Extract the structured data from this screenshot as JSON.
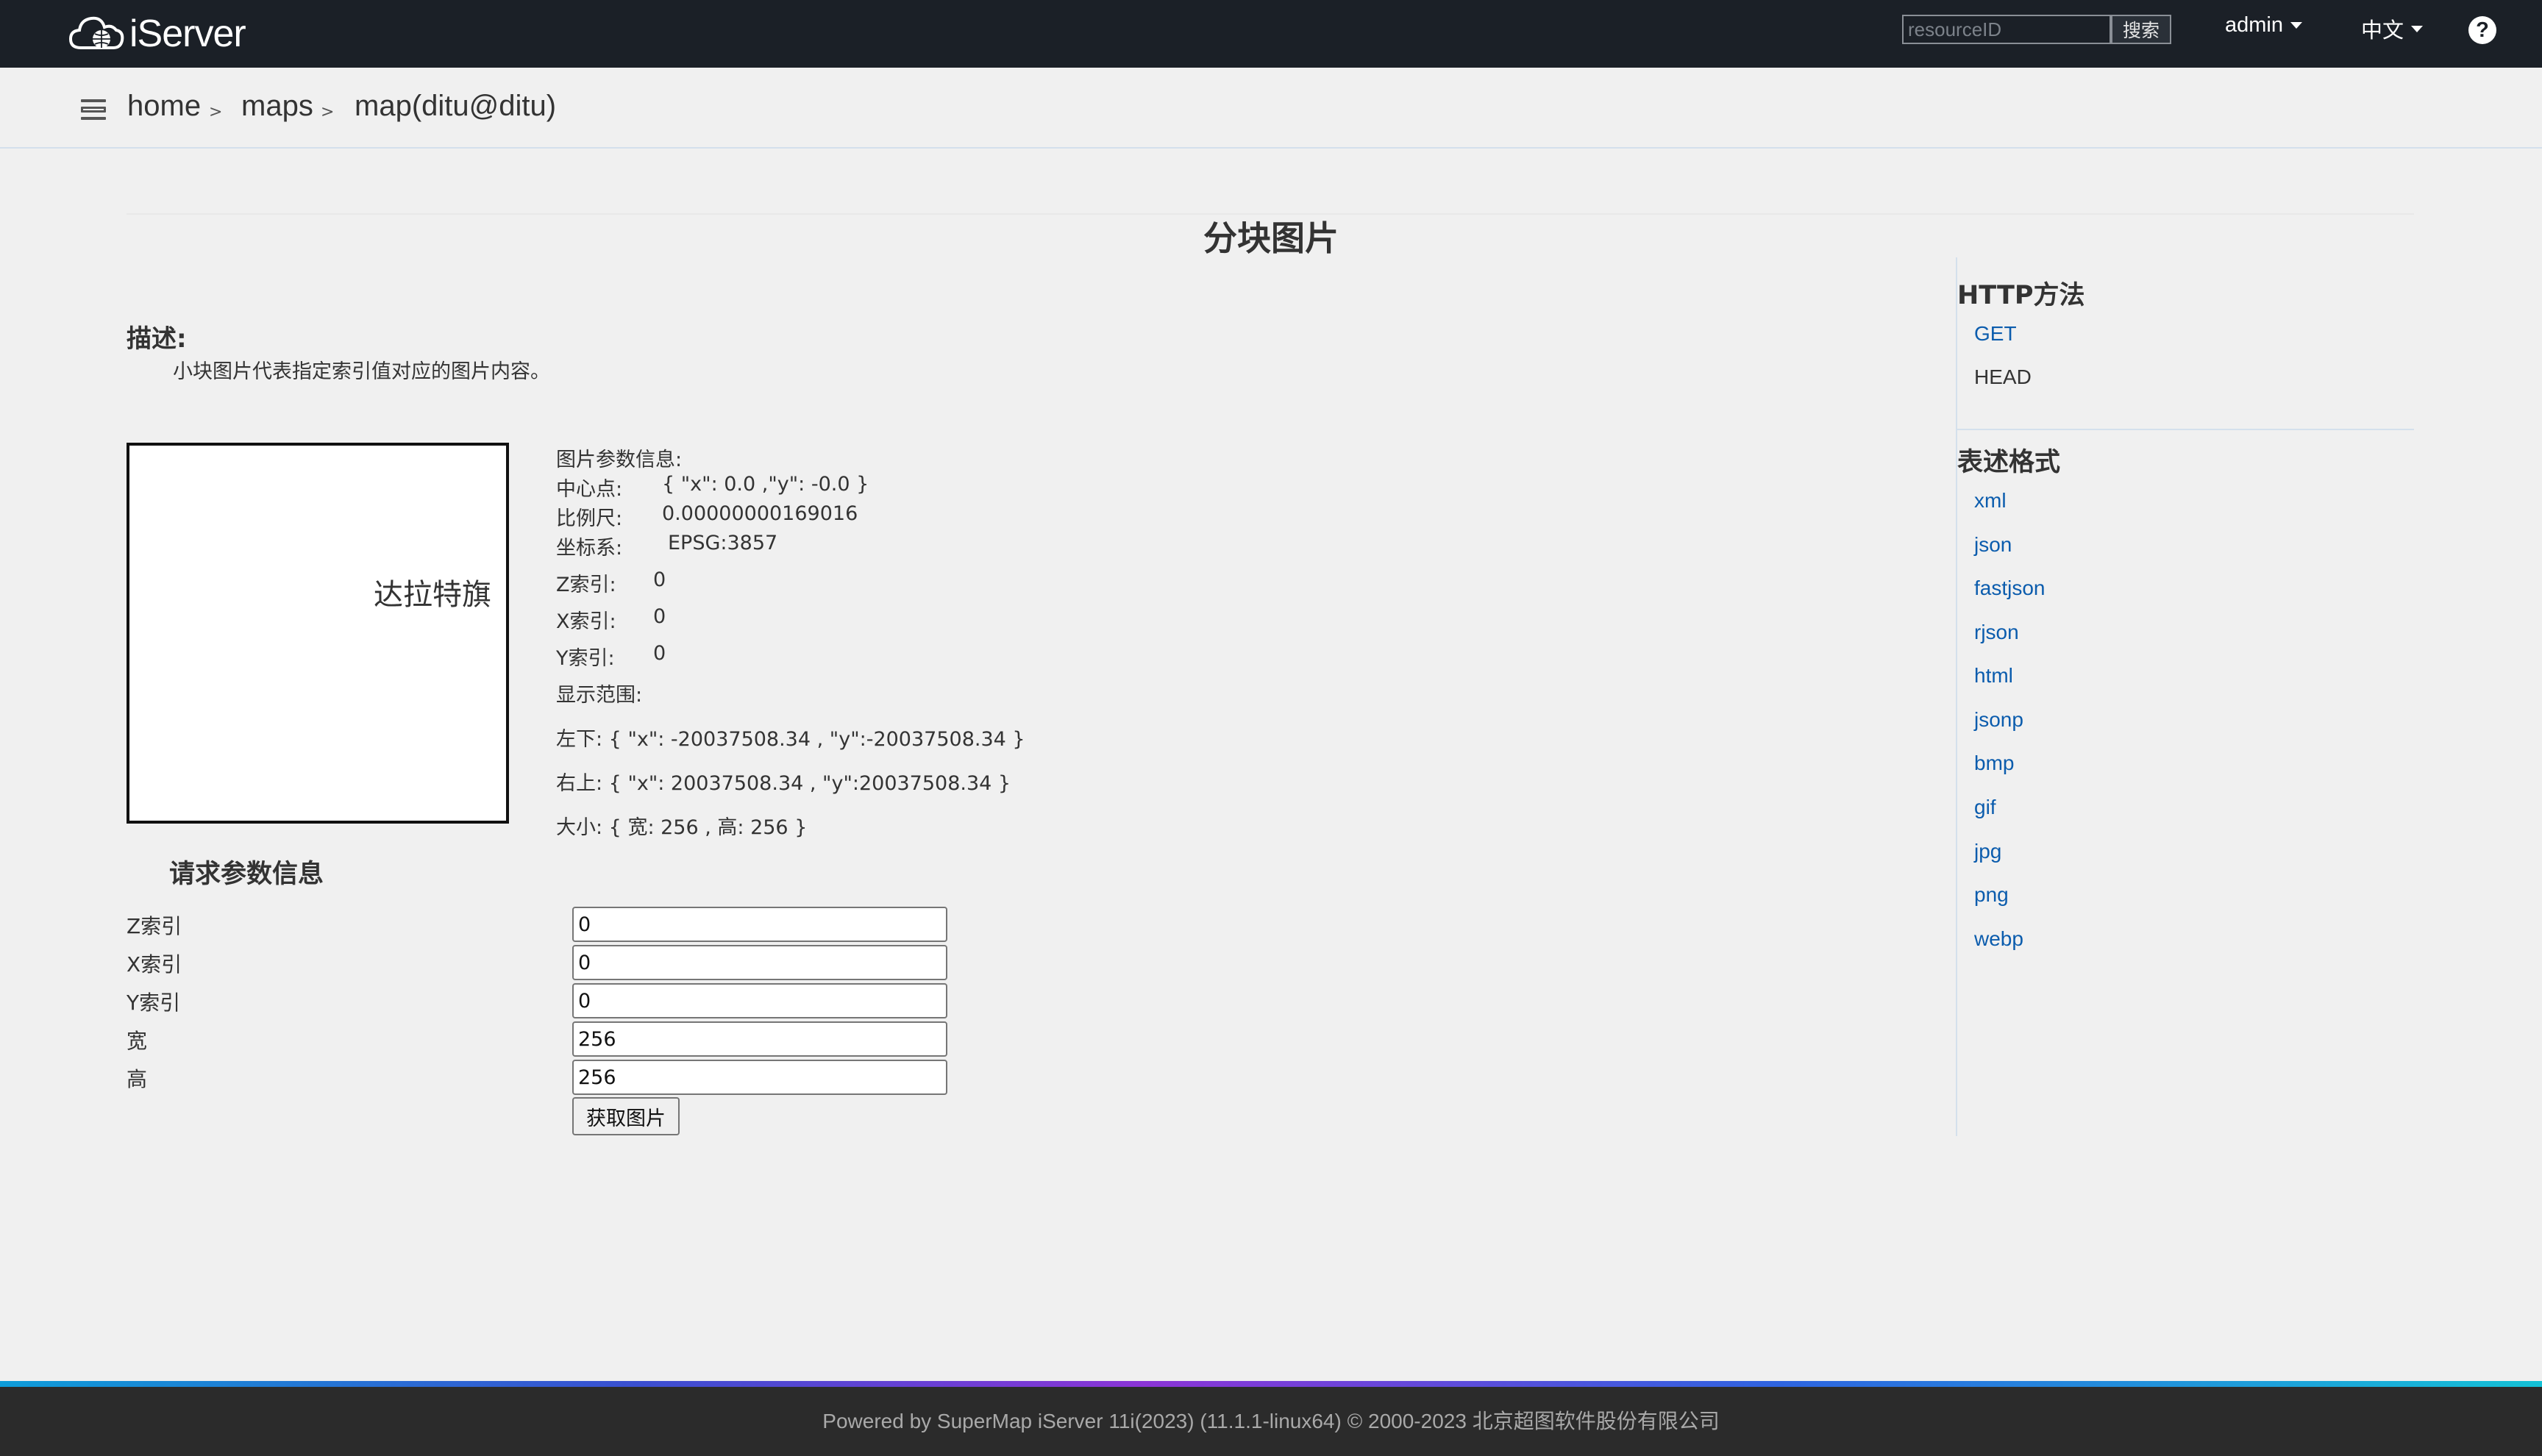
{
  "header": {
    "logo_text": "iServer",
    "search": {
      "placeholder": "resourceID",
      "button_label": "搜索"
    },
    "user_menu": "admin",
    "language_menu": "中文",
    "help_label": "?"
  },
  "breadcrumb": [
    {
      "label": "home",
      "sep": ">"
    },
    {
      "label": "maps",
      "sep": ">"
    },
    {
      "label": "map(ditu@ditu)"
    }
  ],
  "main": {
    "title": "分块图片",
    "description_label": "描述:",
    "description": "小块图片代表指定索引值对应的图片内容。",
    "tile_image_label": "达拉特旗",
    "image_info": {
      "heading": "图片参数信息:",
      "center_label": "中心点:",
      "center_value": "{ \"x\": 0.0 ,\"y\": -0.0 }",
      "scale_label": "比例尺:",
      "scale_value": "0.00000000169016",
      "crs_label": "坐标系:",
      "crs_value": "EPSG:3857",
      "z_label": "Z索引:",
      "z_value": "0",
      "x_label": "X索引:",
      "x_value": "0",
      "y_label": "Y索引:",
      "y_value": "0",
      "extent_label": "显示范围:",
      "lower_left": "左下: { \"x\": -20037508.34 , \"y\":-20037508.34 }",
      "upper_right": "右上: { \"x\": 20037508.34 , \"y\":20037508.34 }",
      "size": "大小: { 宽: 256 , 高: 256 }"
    },
    "request_params": {
      "title": "请求参数信息",
      "fields": [
        {
          "label": "Z索引",
          "value": "0"
        },
        {
          "label": "X索引",
          "value": "0"
        },
        {
          "label": "Y索引",
          "value": "0"
        },
        {
          "label": "宽",
          "value": "256"
        },
        {
          "label": "高",
          "value": "256"
        }
      ],
      "submit_label": "获取图片"
    }
  },
  "sidebar": {
    "http_methods_title": "HTTP方法",
    "http_methods": [
      "GET",
      "HEAD"
    ],
    "formats_title": "表述格式",
    "formats": [
      "xml",
      "json",
      "fastjson",
      "rjson",
      "html",
      "jsonp",
      "bmp",
      "gif",
      "jpg",
      "png",
      "webp"
    ]
  },
  "footer": {
    "text": "Powered by SuperMap iServer 11i(2023) (11.1.1-linux64) © 2000-2023 北京超图软件股份有限公司"
  }
}
